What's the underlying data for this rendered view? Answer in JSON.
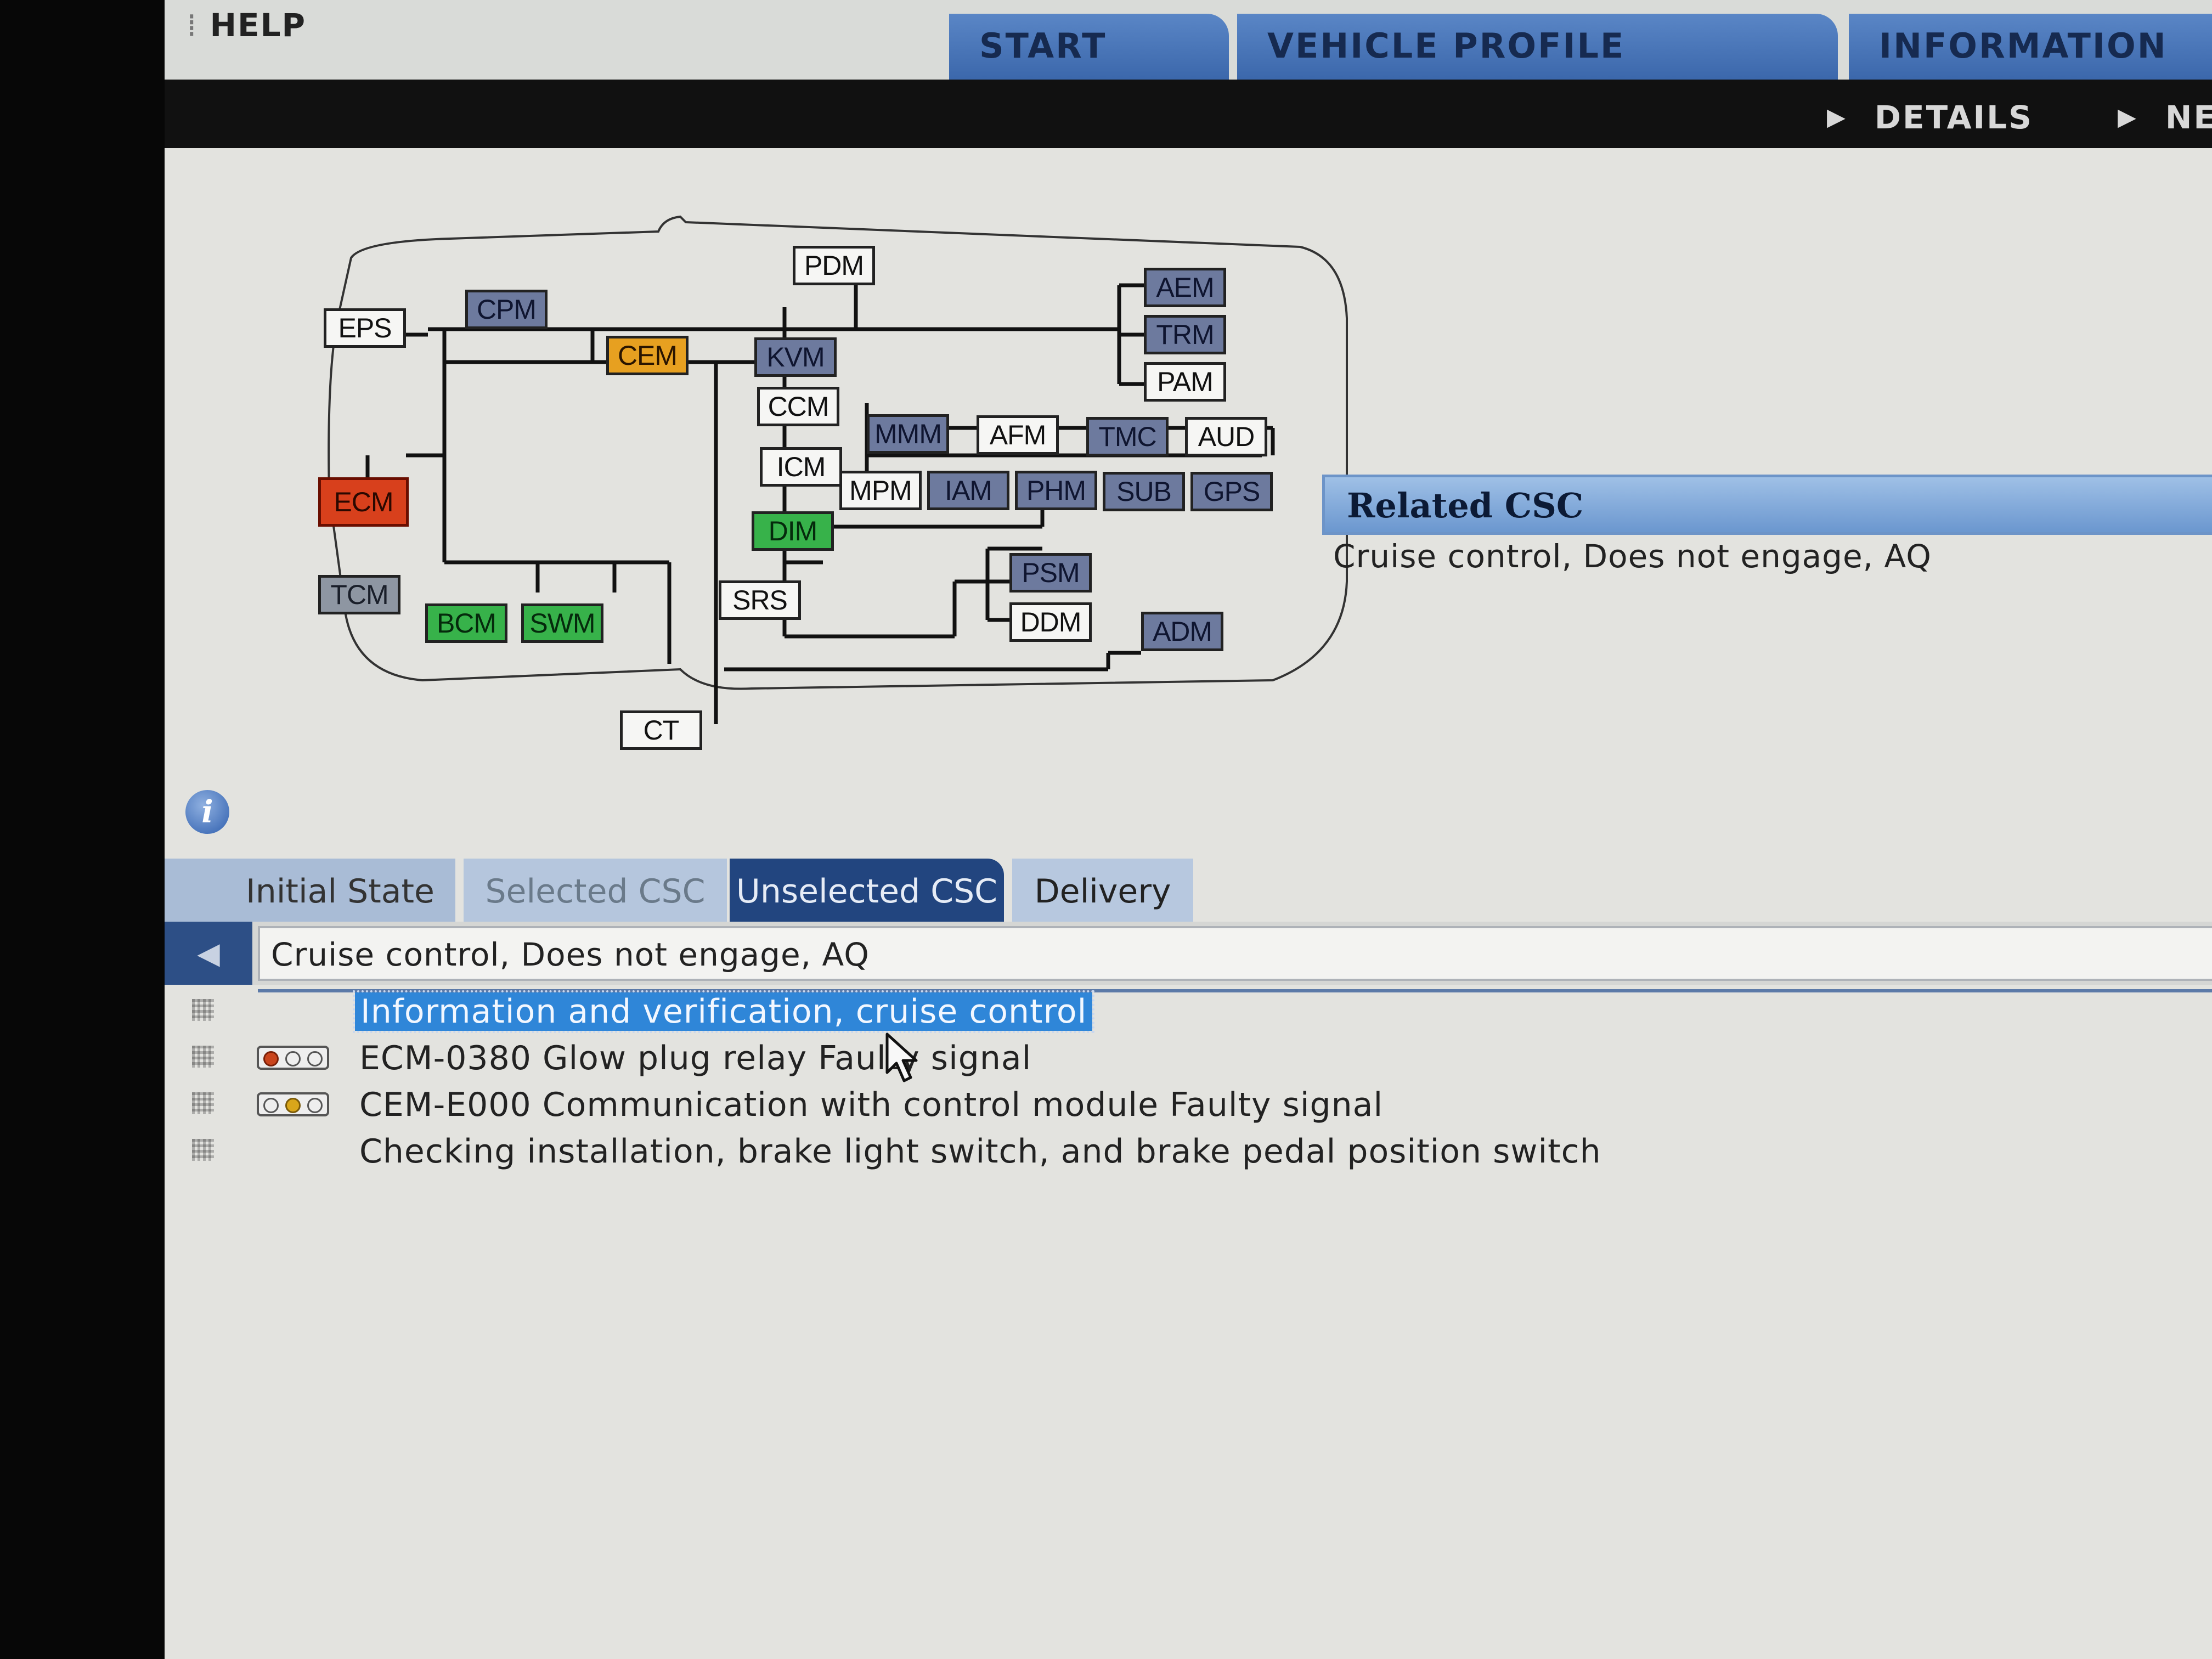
{
  "header": {
    "help_label": "HELP",
    "tabs": [
      {
        "label": "START"
      },
      {
        "label": "VEHICLE PROFILE"
      },
      {
        "label": "INFORMATION"
      }
    ],
    "subnav": [
      {
        "label": "DETAILS"
      },
      {
        "label": "NE"
      }
    ]
  },
  "network": {
    "modules": [
      {
        "label": "PDM",
        "status": "none"
      },
      {
        "label": "CPM",
        "status": "present"
      },
      {
        "label": "EPS",
        "status": "none"
      },
      {
        "label": "CEM",
        "status": "fault-orange"
      },
      {
        "label": "KVM",
        "status": "present"
      },
      {
        "label": "CCM",
        "status": "none"
      },
      {
        "label": "ICM",
        "status": "none"
      },
      {
        "label": "DIM",
        "status": "ok-green"
      },
      {
        "label": "MMM",
        "status": "present"
      },
      {
        "label": "AFM",
        "status": "none"
      },
      {
        "label": "TMC",
        "status": "present"
      },
      {
        "label": "AUD",
        "status": "none"
      },
      {
        "label": "MPM",
        "status": "none"
      },
      {
        "label": "IAM",
        "status": "present"
      },
      {
        "label": "PHM",
        "status": "present"
      },
      {
        "label": "SUB",
        "status": "present"
      },
      {
        "label": "GPS",
        "status": "present"
      },
      {
        "label": "AEM",
        "status": "present"
      },
      {
        "label": "TRM",
        "status": "present"
      },
      {
        "label": "PAM",
        "status": "none"
      },
      {
        "label": "ECM",
        "status": "fault-red"
      },
      {
        "label": "TCM",
        "status": "present-gray"
      },
      {
        "label": "BCM",
        "status": "ok-green"
      },
      {
        "label": "SWM",
        "status": "ok-green"
      },
      {
        "label": "SRS",
        "status": "none"
      },
      {
        "label": "PSM",
        "status": "present"
      },
      {
        "label": "DDM",
        "status": "none"
      },
      {
        "label": "ADM",
        "status": "present"
      },
      {
        "label": "CT",
        "status": "none"
      }
    ],
    "colors": {
      "present": "#6d7a9e",
      "fault-orange": "#e7a020",
      "fault-red": "#d8401c",
      "ok-green": "#37b24a"
    }
  },
  "related_csc": {
    "title": "Related CSC",
    "text": "Cruise control, Does not engage, AQ"
  },
  "info_icon": "info-icon",
  "bottom_tabs": [
    {
      "label": "Initial State"
    },
    {
      "label": "Selected CSC"
    },
    {
      "label": "Unselected CSC",
      "active": true
    },
    {
      "label": "Delivery"
    }
  ],
  "filter": {
    "back_icon": "triangle-left-icon",
    "value": "Cruise control, Does not engage, AQ"
  },
  "list": [
    {
      "text": "Information and verification, cruise control",
      "selected": true,
      "lights": "none"
    },
    {
      "text": "ECM-0380 Glow plug relay Faulty signal",
      "selected": false,
      "lights": "red"
    },
    {
      "text": "CEM-E000 Communication with control module Faulty signal",
      "selected": false,
      "lights": "yellow"
    },
    {
      "text": "Checking installation, brake light switch, and brake pedal position switch",
      "selected": false,
      "lights": "none"
    }
  ]
}
